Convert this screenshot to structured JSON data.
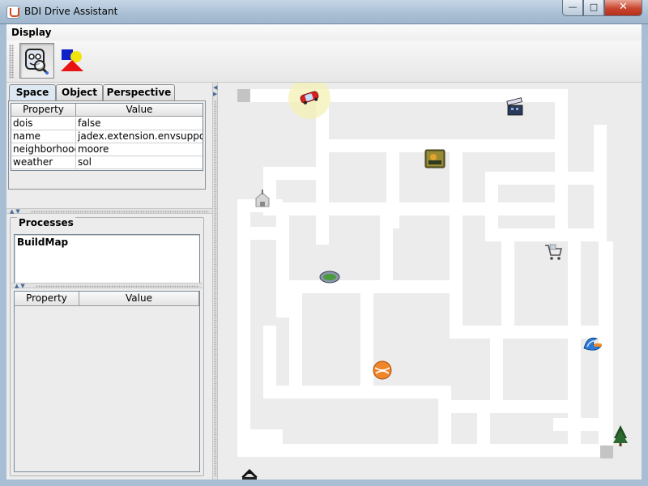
{
  "window": {
    "title": "BDI Drive Assistant"
  },
  "window_buttons": {
    "minimize": "—",
    "maximize": "□",
    "close": "✕"
  },
  "menu": {
    "display": "Display"
  },
  "toolbar": {
    "buttons": [
      {
        "icon": "observer-magnifier-icon",
        "pressed": true
      },
      {
        "icon": "shapes-icon",
        "pressed": false
      }
    ]
  },
  "tabs": [
    {
      "label": "Space",
      "active": true
    },
    {
      "label": "Object"
    },
    {
      "label": "Perspective"
    }
  ],
  "space_table": {
    "headers": [
      "Property",
      "Value"
    ],
    "rows": [
      [
        "dois",
        "false"
      ],
      [
        "name",
        "jadex.extension.envsuppor..."
      ],
      [
        "neighborhood",
        "moore"
      ],
      [
        "weather",
        "sol"
      ]
    ]
  },
  "processes": {
    "title": "Processes",
    "items": [
      "BuildMap"
    ],
    "headers": [
      "Property",
      "Value"
    ]
  },
  "map": {
    "background": "#ececec",
    "road_color": "#ffffff",
    "objects": [
      {
        "name": "car",
        "icon": "red-car-icon",
        "highlighted": true
      },
      {
        "name": "film-clapper",
        "icon": "clapper-icon"
      },
      {
        "name": "poster",
        "icon": "poster-icon"
      },
      {
        "name": "church",
        "icon": "church-icon"
      },
      {
        "name": "shopping-cart",
        "icon": "cart-icon"
      },
      {
        "name": "stadium",
        "icon": "stadium-icon"
      },
      {
        "name": "surf-wave",
        "icon": "wave-icon"
      },
      {
        "name": "tennis-ball",
        "icon": "ball-icon"
      },
      {
        "name": "tree",
        "icon": "tree-icon"
      },
      {
        "name": "stage-tent",
        "icon": "tent-icon"
      }
    ]
  }
}
